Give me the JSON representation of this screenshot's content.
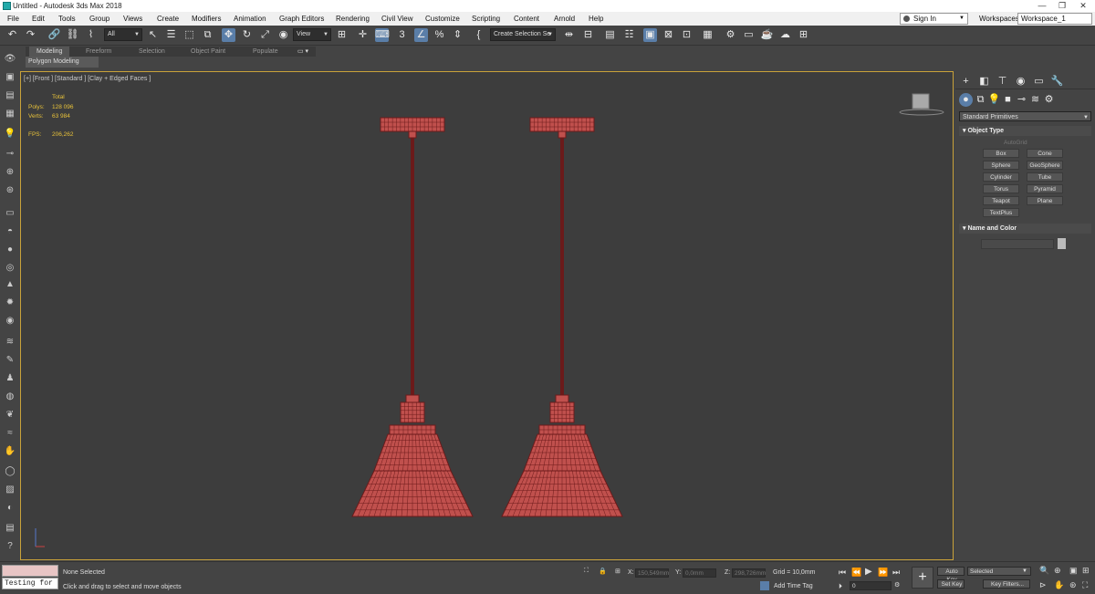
{
  "window": {
    "title": "Untitled - Autodesk 3ds Max 2018",
    "controls": [
      "—",
      "❐",
      "✕"
    ]
  },
  "menu": {
    "items": [
      "File",
      "Edit",
      "Tools",
      "Group",
      "Views",
      "Create",
      "Modifiers",
      "Animation",
      "Graph Editors",
      "Rendering",
      "Civil View",
      "Customize",
      "Scripting",
      "Content",
      "Arnold",
      "Help"
    ],
    "sign_in": "Sign In",
    "workspaces_label": "Workspaces:",
    "workspace_value": "Workspace_1"
  },
  "toolbar": {
    "selection_filter": "All",
    "reference_coord": "View",
    "named_selection": "Create Selection Se"
  },
  "ribbon": {
    "tabs": [
      "Modeling",
      "Freeform",
      "Selection",
      "Object Paint",
      "Populate"
    ],
    "active_tab": "Modeling",
    "panel_label": "Polygon Modeling"
  },
  "viewport": {
    "label": "[+] [Front ] [Standard ] [Clay + Edged Faces ]",
    "stats": {
      "total_label": "Total",
      "polys_label": "Polys:",
      "polys": "128 096",
      "verts_label": "Verts:",
      "verts": "63 984",
      "fps_label": "FPS:",
      "fps": "206,262"
    },
    "colors": {
      "wire": "#6b1a1a",
      "shade": "#c0504d",
      "frame": "#c9a23a"
    }
  },
  "command_panel": {
    "category": "Standard Primitives",
    "object_type_title": "Object Type",
    "autogrid": "AutoGrid",
    "buttons": [
      "Box",
      "Cone",
      "Sphere",
      "GeoSphere",
      "Cylinder",
      "Tube",
      "Torus",
      "Pyramid",
      "Teapot",
      "Plane",
      "TextPlus"
    ],
    "name_color_title": "Name and Color"
  },
  "status": {
    "script_listener": "Testing for",
    "selection": "None Selected",
    "prompt": "Click and drag to select and move objects",
    "x_label": "X:",
    "x_value": "150,549mm",
    "y_label": "Y:",
    "y_value": "0,0mm",
    "z_label": "Z:",
    "z_value": "298,726mm",
    "grid": "Grid = 10,0mm",
    "add_time_tag": "Add Time Tag",
    "frame": "0",
    "auto_key": "Auto Key",
    "set_key": "Set Key",
    "key_mode": "Selected",
    "key_filters": "Key Filters..."
  }
}
